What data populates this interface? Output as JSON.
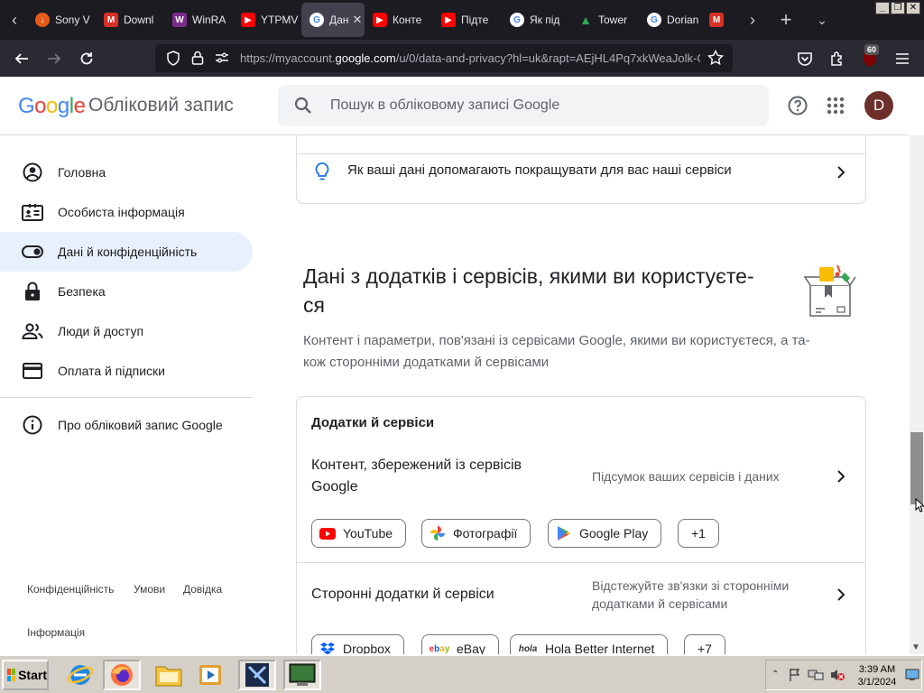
{
  "browser": {
    "tabs": [
      {
        "title": "Sony V",
        "color": "#e8591a",
        "glyph": "↓"
      },
      {
        "title": "Downl",
        "color": "#d93025",
        "glyph": "M"
      },
      {
        "title": "WinRA",
        "color": "#7b2d8e",
        "glyph": "W"
      },
      {
        "title": "YTPMV",
        "color": "#ff0000",
        "glyph": "▶"
      },
      {
        "title": "Дан",
        "color": "#ffffff",
        "glyph": "G"
      },
      {
        "title": "Конте",
        "color": "#ff0000",
        "glyph": "▶"
      },
      {
        "title": "Підте",
        "color": "#ff0000",
        "glyph": "▶"
      },
      {
        "title": "Як під",
        "color": "#ffffff",
        "glyph": "G"
      },
      {
        "title": "Tower",
        "color": "#34a853",
        "glyph": "▲"
      },
      {
        "title": "Dorian",
        "color": "#ffffff",
        "glyph": "G"
      },
      {
        "title": "",
        "color": "#d93025",
        "glyph": "M"
      }
    ],
    "url_prefix": "https://myaccount.",
    "url_domain": "google.com",
    "url_suffix": "/u/0/data-and-privacy?hl=uk&rapt=AEjHL4Pq7xkWeaJolk-G",
    "extension_badge": "60"
  },
  "header": {
    "logo": "Google",
    "title": "Обліковий запис",
    "search_placeholder": "Пошук в обліковому записі Google",
    "avatar_letter": "D"
  },
  "sidebar": {
    "items": [
      {
        "label": "Головна",
        "icon": "account-circle-icon"
      },
      {
        "label": "Особиста інформація",
        "icon": "id-card-icon"
      },
      {
        "label": "Дані й конфіденційність",
        "icon": "toggle-icon"
      },
      {
        "label": "Безпека",
        "icon": "lock-icon"
      },
      {
        "label": "Люди й доступ",
        "icon": "people-icon"
      },
      {
        "label": "Оплата й підписки",
        "icon": "credit-card-icon"
      }
    ],
    "about": "Про обліковий запис Google",
    "footer": {
      "privacy": "Конфіденційність",
      "terms": "Умови",
      "help": "Довідка",
      "info": "Інформація"
    }
  },
  "main": {
    "hint_row": "Як ваші дані допомагають покращувати для вас наші сервіси",
    "section_title_line1": "Дані з додатків і сервісів, якими ви користуєте-",
    "section_title_line2": "ся",
    "section_desc_line1": "Контент і параметри, пов'язані із сервісами Google, якими ви користуєтеся, а та-",
    "section_desc_line2": "кож сторонніми додатками й сервісами",
    "apps_card": {
      "heading": "Додатки й сервіси",
      "row1_title_line1": "Контент, збережений із сервісів",
      "row1_title_line2": "Google",
      "row1_sub": "Підсумок ваших сервісів і даних",
      "chips1": [
        "YouTube",
        "Фотографії",
        "Google Play",
        "+1"
      ],
      "row2_title": "Сторонні додатки й сервіси",
      "row2_sub_line1": "Відстежуйте зв'язки зі сторонніми",
      "row2_sub_line2": "додатками й сервісами",
      "chips2": [
        "Dropbox",
        "eBay",
        "Hola Better Internet",
        "+7"
      ]
    }
  },
  "taskbar": {
    "start": "Start",
    "time": "3:39 AM",
    "date": "3/1/2024"
  }
}
